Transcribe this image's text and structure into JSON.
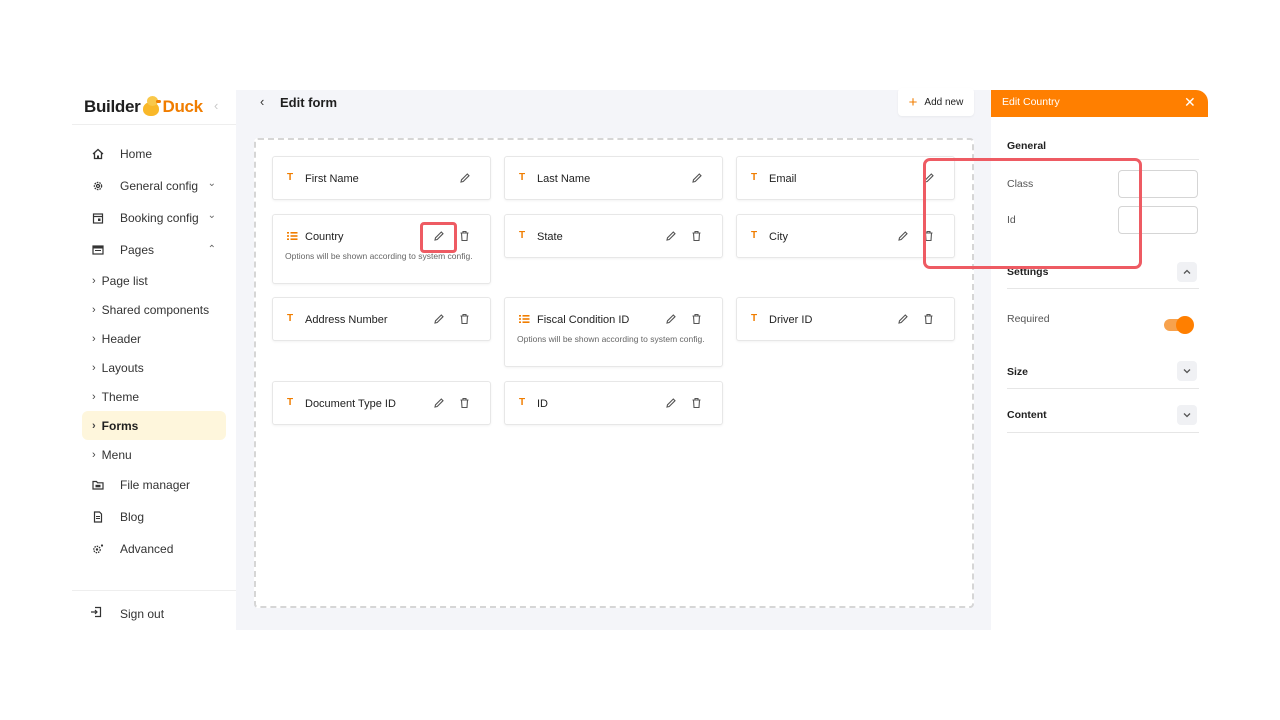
{
  "logo": {
    "part1": "Builder",
    "part2": "Duck"
  },
  "sidebar": {
    "items": [
      {
        "label": "Home",
        "icon": "home-icon"
      },
      {
        "label": "General config",
        "icon": "gear-icon"
      },
      {
        "label": "Booking config",
        "icon": "calendar-icon"
      },
      {
        "label": "Pages",
        "icon": "pages-icon"
      }
    ],
    "pages_sub": [
      "Page list",
      "Shared components",
      "Header",
      "Layouts",
      "Theme",
      "Forms",
      "Menu"
    ],
    "active_sub": "Forms",
    "more_items": [
      {
        "label": "File manager",
        "icon": "folder-icon"
      },
      {
        "label": "Blog",
        "icon": "document-icon"
      },
      {
        "label": "Advanced",
        "icon": "advanced-gear-icon"
      }
    ],
    "signout": "Sign out"
  },
  "main": {
    "title": "Edit form",
    "add_new": "Add new",
    "fields": [
      {
        "label": "First Name",
        "type": "text"
      },
      {
        "label": "Last Name",
        "type": "text"
      },
      {
        "label": "Email",
        "type": "text"
      },
      {
        "label": "Country",
        "type": "list",
        "hint": "Options will be shown according to system config."
      },
      {
        "label": "State",
        "type": "text"
      },
      {
        "label": "City",
        "type": "text"
      },
      {
        "label": "Address Number",
        "type": "text"
      },
      {
        "label": "Fiscal Condition ID",
        "type": "list",
        "hint": "Options will be shown according to system config."
      },
      {
        "label": "Driver ID",
        "type": "text"
      },
      {
        "label": "Document Type ID",
        "type": "text"
      },
      {
        "label": "ID",
        "type": "text"
      }
    ]
  },
  "panel": {
    "title": "Edit Country",
    "general": "General",
    "class_label": "Class",
    "id_label": "Id",
    "settings": "Settings",
    "required_label": "Required",
    "required_on": true,
    "size": "Size",
    "content": "Content"
  },
  "colors": {
    "accent": "#ff7f00",
    "highlight": "#ee5b63",
    "active_bg": "#fef6dc"
  }
}
